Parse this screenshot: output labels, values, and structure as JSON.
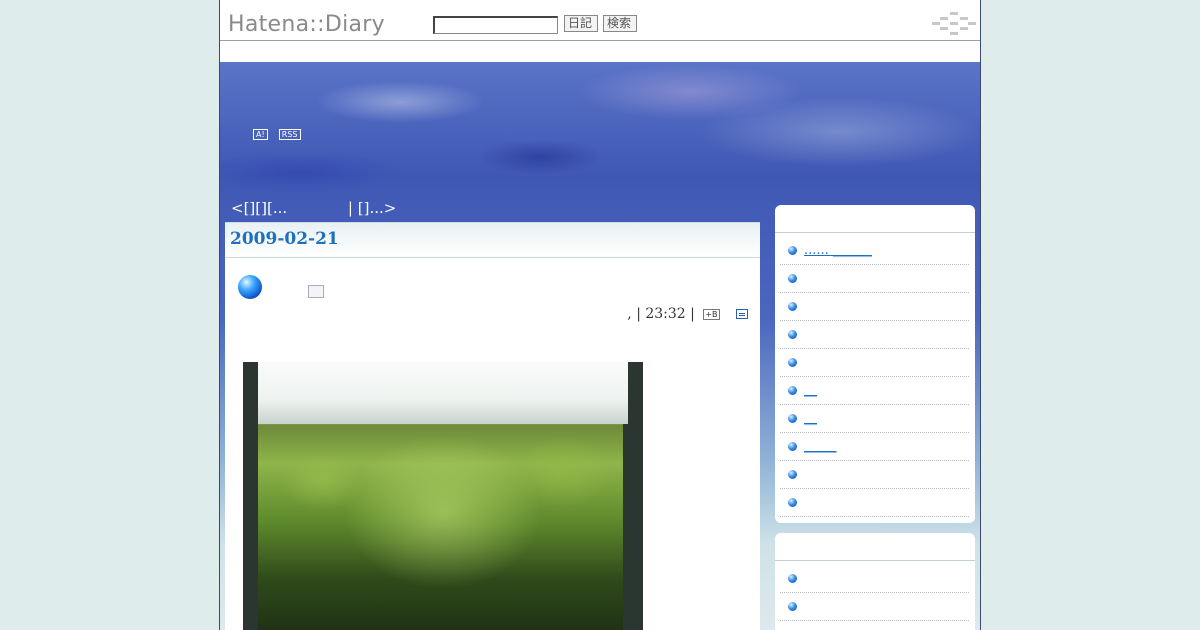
{
  "header": {
    "logo": "Hatena::Diary",
    "search_placeholder": "",
    "diary_button": "日記",
    "search_button": "検索"
  },
  "banner": {
    "badge_a": "A!",
    "badge_rss": "RSS",
    "nav_prev": "<[][][...",
    "nav_next": "| []...>"
  },
  "main": {
    "date": "2009-02-21",
    "entry_footer_text": ",  | 23:32 |",
    "hb_icon": "+B"
  },
  "sidebar": {
    "box1_items": [
      {
        "label": "...... ______"
      },
      {
        "label": ""
      },
      {
        "label": ""
      },
      {
        "label": ""
      },
      {
        "label": ""
      },
      {
        "label": "__"
      },
      {
        "label": "__"
      },
      {
        "label": "_____"
      },
      {
        "label": ""
      },
      {
        "label": ""
      }
    ],
    "box2_items": [
      {
        "label": ""
      },
      {
        "label": ""
      },
      {
        "label": ""
      }
    ]
  }
}
